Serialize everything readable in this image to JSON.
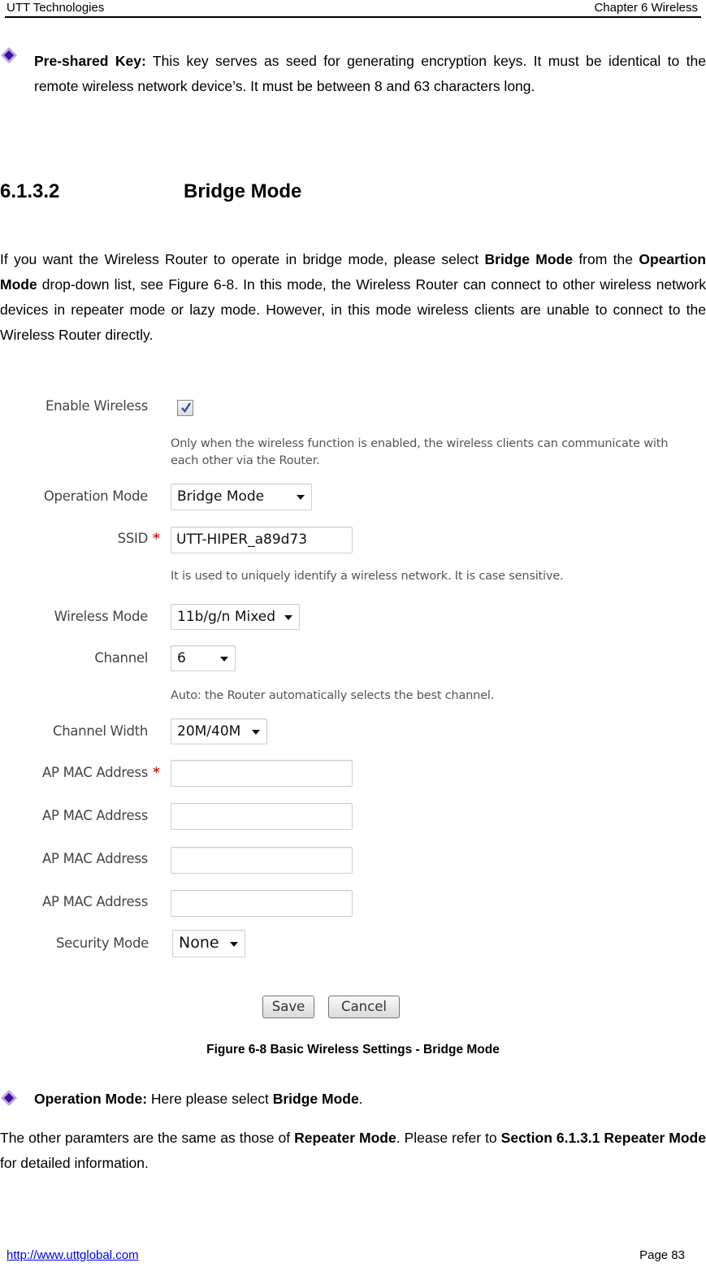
{
  "header": {
    "left": "UTT Technologies",
    "right": "Chapter 6 Wireless"
  },
  "bullet_preshared": {
    "term": "Pre-shared Key:",
    "text": " This key serves as seed for generating encryption keys. It must be identical to the remote wireless network device’s. It must be between 8 and 63 characters long."
  },
  "section": {
    "number": "6.1.3.2",
    "title": "Bridge Mode"
  },
  "intro": {
    "t1": "If you want the Wireless Router to operate in bridge mode, please select ",
    "b1": "Bridge Mode",
    "t2": " from the ",
    "b2": "Opeartion Mode",
    "t3": " drop-down list, see Figure 6-8. In this mode, the Wireless Router can connect to other wireless network devices in repeater mode or lazy mode. However, in this mode wireless clients are unable to connect to the Wireless Router directly."
  },
  "form": {
    "enable_wireless": {
      "label": "Enable Wireless",
      "checked": true
    },
    "enable_hint": "Only when the wireless function is enabled, the wireless clients can communicate with each other via the Router.",
    "operation_mode": {
      "label": "Operation Mode",
      "value": "Bridge Mode"
    },
    "ssid": {
      "label": "SSID",
      "required_mark": "*",
      "value": "UTT-HIPER_a89d73"
    },
    "ssid_hint": "It is used to uniquely identify a wireless network. It is case sensitive.",
    "wireless_mode": {
      "label": "Wireless Mode",
      "value": "11b/g/n Mixed"
    },
    "channel": {
      "label": "Channel",
      "value": "6"
    },
    "channel_hint": "Auto: the Router automatically selects the best channel.",
    "channel_width": {
      "label": "Channel Width",
      "value": "20M/40M"
    },
    "ap_mac": [
      {
        "label": "AP MAC Address",
        "required_mark": "*",
        "value": ""
      },
      {
        "label": "AP MAC Address",
        "value": ""
      },
      {
        "label": "AP MAC Address",
        "value": ""
      },
      {
        "label": "AP MAC Address",
        "value": ""
      }
    ],
    "security_mode": {
      "label": "Security Mode",
      "value": "None"
    },
    "save_label": "Save",
    "cancel_label": "Cancel"
  },
  "caption": "Figure 6-8 Basic Wireless Settings - Bridge Mode",
  "bullet_opmode": {
    "term": "Operation Mode:",
    "text": " Here please select ",
    "value": "Bridge Mode",
    "end": "."
  },
  "closing": {
    "t1": "The other paramters are the same as those of ",
    "b1": "Repeater Mode",
    "t2": ". Please refer to ",
    "b2": "Section 6.1.3.1 Repeater Mode",
    "t3": " for detailed information."
  },
  "footer": {
    "url": "http://www.uttglobal.com",
    "page": "Page 83"
  },
  "colors": {
    "bullet": "#5a2ca0",
    "required": "#e01b1b",
    "link": "#0000ee"
  }
}
